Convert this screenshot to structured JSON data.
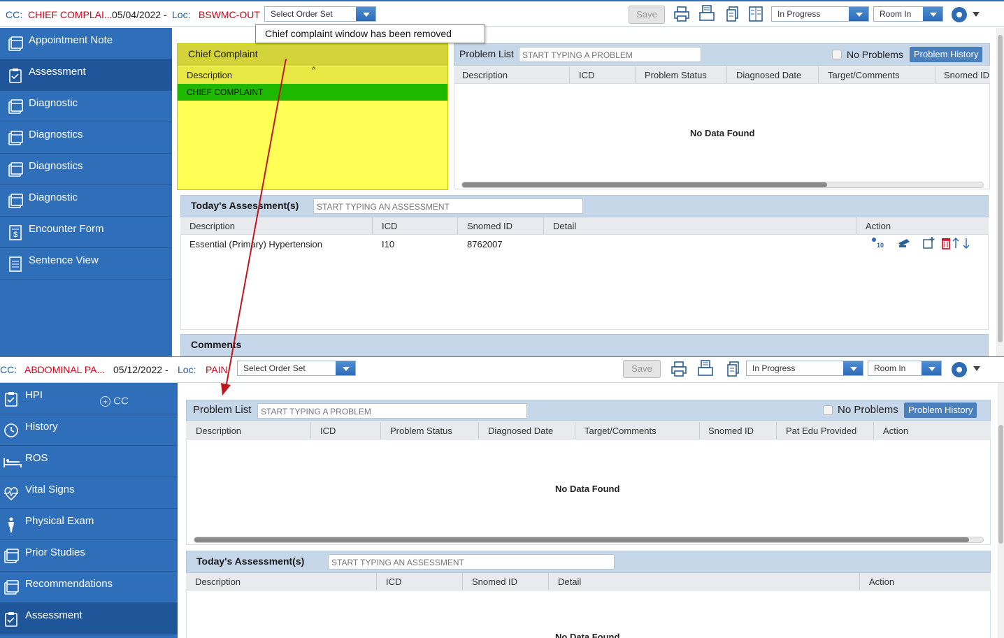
{
  "top": {
    "toolbar": {
      "cc_label": "CC:",
      "cc_value": "CHIEF COMPLAI...",
      "date": "05/04/2022 -",
      "loc_label": "Loc:",
      "loc_value": "BSWMC-OUT",
      "order_set": "Select Order Set",
      "save": "Save",
      "status": "In Progress",
      "room": "Room In"
    },
    "tooltip": "Chief complaint window has been removed",
    "sidebar": [
      {
        "label": "Appointment Note",
        "icon": "document-icon"
      },
      {
        "label": "Assessment",
        "icon": "clipboard-icon"
      },
      {
        "label": "Diagnostic",
        "icon": "document-icon"
      },
      {
        "label": "Diagnostics",
        "icon": "document-icon"
      },
      {
        "label": "Diagnostics",
        "icon": "document-icon"
      },
      {
        "label": "Diagnostic",
        "icon": "document-icon"
      },
      {
        "label": "Encounter Form",
        "icon": "invoice-icon"
      },
      {
        "label": "Sentence View",
        "icon": "list-document-icon"
      }
    ],
    "chief_complaint": {
      "title": "Chief Complaint",
      "col": "Description",
      "sort": "^",
      "row": "CHIEF COMPLAINT"
    },
    "problem_list": {
      "title": "Problem List",
      "placeholder": "START TYPING A PROBLEM",
      "no_problems": "No Problems",
      "history": "Problem History",
      "cols": [
        "Description",
        "ICD",
        "Problem Status",
        "Diagnosed Date",
        "Target/Comments",
        "Snomed ID"
      ],
      "empty": "No Data Found"
    },
    "assessment": {
      "title": "Today's Assessment(s)",
      "placeholder": "START TYPING AN ASSESSMENT",
      "cols": [
        "Description",
        "ICD",
        "Snomed ID",
        "Detail",
        "Action"
      ],
      "row": {
        "desc": "Essential (Primary) Hypertension",
        "icd": "I10",
        "snomed": "8762007"
      }
    },
    "comments": "Comments"
  },
  "bottom": {
    "toolbar": {
      "cc_label": "CC:",
      "cc_value": "ABDOMINAL PA...",
      "date": "05/12/2022 -",
      "loc_label": "Loc:",
      "loc_value": "PAIN",
      "order_set": "Select Order Set",
      "save": "Save",
      "status": "In Progress",
      "room": "Room In"
    },
    "add_cc": "CC",
    "sidebar": [
      {
        "label": "HPI",
        "icon": "clipboard-icon"
      },
      {
        "label": "History",
        "icon": "history-clock-icon"
      },
      {
        "label": "ROS",
        "icon": "bed-icon"
      },
      {
        "label": "Vital Signs",
        "icon": "heartbeat-icon"
      },
      {
        "label": "Physical Exam",
        "icon": "person-icon"
      },
      {
        "label": "Prior Studies",
        "icon": "document-icon"
      },
      {
        "label": "Recommendations",
        "icon": "document-icon"
      },
      {
        "label": "Assessment",
        "icon": "clipboard-icon"
      }
    ],
    "problem_list": {
      "title": "Problem List",
      "placeholder": "START TYPING A PROBLEM",
      "no_problems": "No Problems",
      "history": "Problem History",
      "cols": [
        "Description",
        "ICD",
        "Problem Status",
        "Diagnosed Date",
        "Target/Comments",
        "Snomed ID",
        "Pat Edu Provided",
        "Action"
      ],
      "empty": "No Data Found"
    },
    "assessment": {
      "title": "Today's Assessment(s)",
      "placeholder": "START TYPING AN ASSESSMENT",
      "cols": [
        "Description",
        "ICD",
        "Snomed ID",
        "Detail",
        "Action"
      ],
      "empty": "No Data Found"
    }
  }
}
